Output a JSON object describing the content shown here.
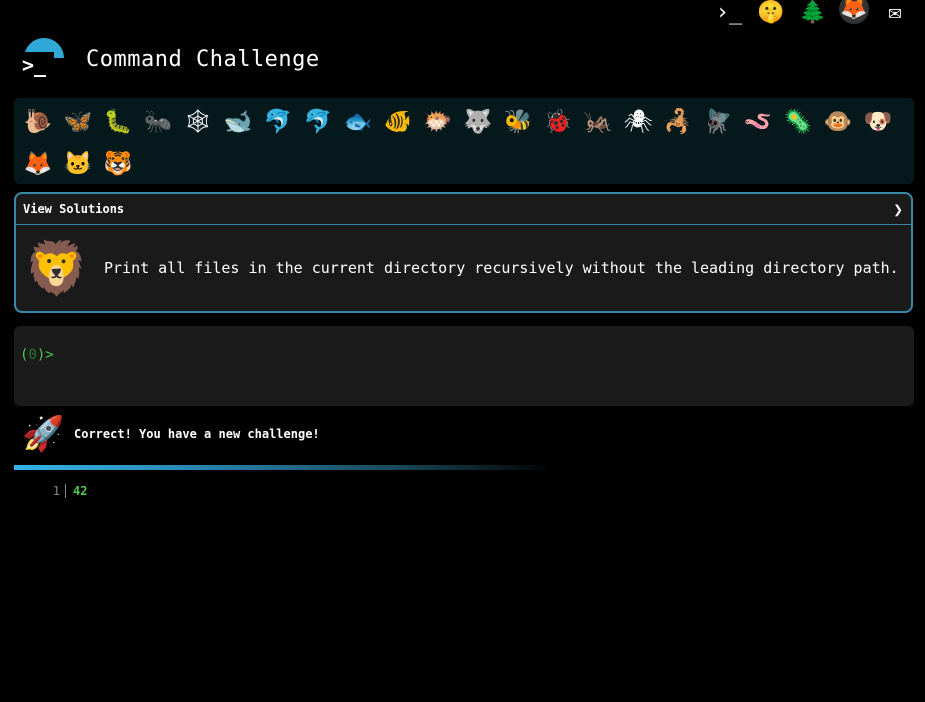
{
  "topbar": {
    "icons": [
      {
        "name": "terminal-icon",
        "glyph": "›_"
      },
      {
        "name": "shush-emoji-icon",
        "glyph": "🤫"
      },
      {
        "name": "tree-icon",
        "glyph": "🌲"
      },
      {
        "name": "gitlab-fox-icon",
        "glyph": "🦊"
      },
      {
        "name": "mail-icon",
        "glyph": "✉"
      }
    ]
  },
  "header": {
    "logo_glyph": ">_",
    "title": "Command Challenge"
  },
  "levels": [
    {
      "glyph": "🐌",
      "state": "done"
    },
    {
      "glyph": "🦋",
      "state": "done"
    },
    {
      "glyph": "🐛",
      "state": "done"
    },
    {
      "glyph": "🐜",
      "state": "done"
    },
    {
      "glyph": "🕸",
      "state": "done"
    },
    {
      "glyph": "🐋",
      "state": "done"
    },
    {
      "glyph": "🐬",
      "state": "done"
    },
    {
      "glyph": "🐬",
      "state": "done"
    },
    {
      "glyph": "🐟",
      "state": "done"
    },
    {
      "glyph": "🐠",
      "state": "done"
    },
    {
      "glyph": "🐡",
      "state": "done"
    },
    {
      "glyph": "🐺",
      "state": "done"
    },
    {
      "glyph": "🐝",
      "state": "done"
    },
    {
      "glyph": "🐞",
      "state": "done"
    },
    {
      "glyph": "🦗",
      "state": "done"
    },
    {
      "glyph": "🕷",
      "state": "done"
    },
    {
      "glyph": "🦂",
      "state": "done"
    },
    {
      "glyph": "🪰",
      "state": "done"
    },
    {
      "glyph": "🪱",
      "state": "done"
    },
    {
      "glyph": "🦠",
      "state": "done"
    },
    {
      "glyph": "🐵",
      "state": "done"
    },
    {
      "glyph": "🐶",
      "state": "done"
    },
    {
      "glyph": "🦊",
      "state": "done"
    },
    {
      "glyph": "🐱",
      "state": "done"
    },
    {
      "glyph": "🐯",
      "state": "current"
    }
  ],
  "solutions": {
    "label": "View Solutions",
    "chevron": "❯"
  },
  "challenge": {
    "glyph": "🦁",
    "description": "Print all files in the current directory recursively without the leading directory path."
  },
  "terminal": {
    "prompt_open": "(",
    "prompt_num": "0",
    "prompt_close": ")>"
  },
  "status": {
    "glyph": "🚀",
    "message": "Correct! You have a new challenge!"
  },
  "output": {
    "line_number": "1",
    "value": "42"
  }
}
